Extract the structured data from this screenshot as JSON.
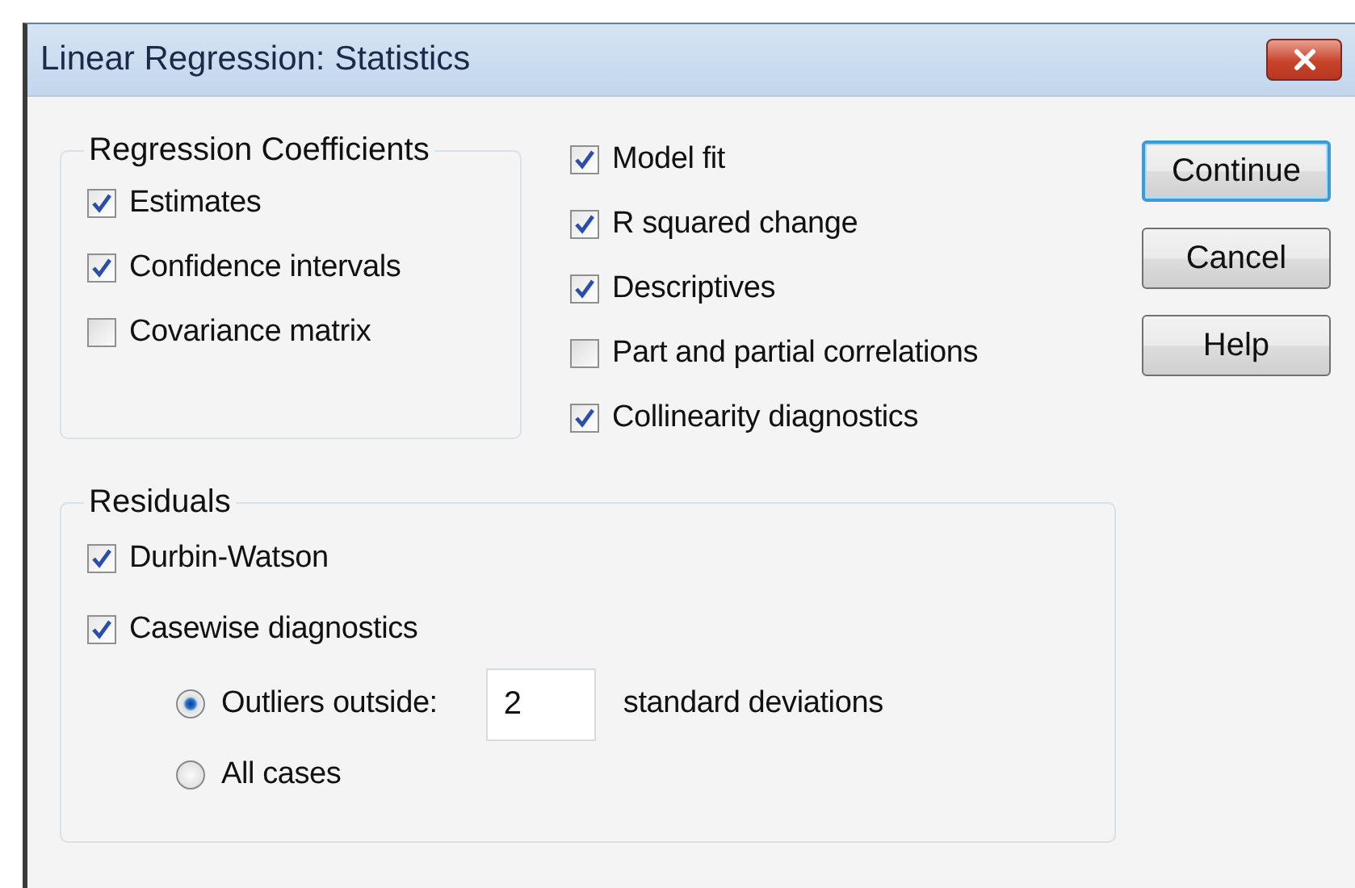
{
  "window": {
    "title": "Linear Regression: Statistics"
  },
  "coefficients": {
    "legend": "Regression Coefficients",
    "items": [
      {
        "label": "Estimates",
        "checked": true
      },
      {
        "label": "Confidence intervals",
        "checked": true
      },
      {
        "label": "Covariance matrix",
        "checked": false
      }
    ]
  },
  "options": [
    {
      "label": "Model fit",
      "checked": true
    },
    {
      "label": "R squared change",
      "checked": true
    },
    {
      "label": "Descriptives",
      "checked": true
    },
    {
      "label": "Part and partial correlations",
      "checked": false
    },
    {
      "label": "Collinearity diagnostics",
      "checked": true
    }
  ],
  "buttons": [
    {
      "label": "Continue",
      "default": true
    },
    {
      "label": "Cancel",
      "default": false
    },
    {
      "label": "Help",
      "default": false
    }
  ],
  "residuals": {
    "legend": "Residuals",
    "items": [
      {
        "label": "Durbin-Watson",
        "checked": true
      },
      {
        "label": "Casewise diagnostics",
        "checked": true
      }
    ],
    "radios": [
      {
        "label": "Outliers outside:",
        "selected": true,
        "value": "2",
        "suffix": "standard deviations"
      },
      {
        "label": "All cases",
        "selected": false
      }
    ]
  }
}
